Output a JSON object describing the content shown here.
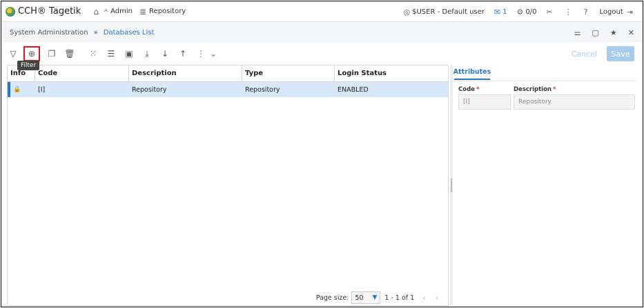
{
  "app": {
    "title": "CCH® Tagetik"
  },
  "topnav": {
    "admin": "Admin",
    "repository": "Repository"
  },
  "user": {
    "label": "$USER - Default user",
    "mail_count": "1",
    "tasks": "0/0",
    "logout": "Logout"
  },
  "breadcrumb": {
    "root": "System Administration",
    "sep": "»",
    "current": "Databases List"
  },
  "toolbar": {
    "tooltip": "Filter",
    "cancel": "Cancel",
    "save": "Save"
  },
  "table": {
    "headers": {
      "info": "Info",
      "code": "Code",
      "description": "Description",
      "type": "Type",
      "login_status": "Login Status"
    },
    "rows": [
      {
        "code": "[I]",
        "description": "Repository",
        "type": "Repository",
        "login_status": "ENABLED"
      }
    ]
  },
  "pager": {
    "label": "Page size:",
    "size": "50",
    "range": "1 - 1 of 1"
  },
  "attributes": {
    "tab": "Attributes",
    "code_label": "Code",
    "code_value": "[I]",
    "desc_label": "Description",
    "desc_value": "Repository",
    "required_mark": "*"
  },
  "colors": {
    "accent": "#2a78c8",
    "highlight": "#d7e9f8",
    "alert": "#e0161b"
  }
}
